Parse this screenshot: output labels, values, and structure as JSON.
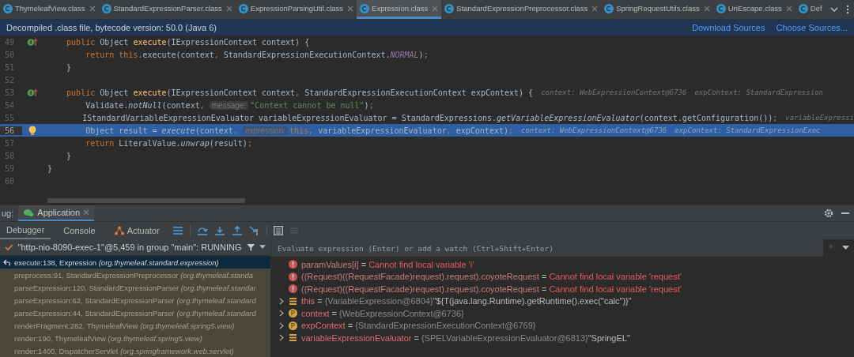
{
  "tabs": [
    {
      "label": "ThymeleafView.class",
      "selected": false,
      "closable": true
    },
    {
      "label": "StandardExpressionParser.class",
      "selected": false,
      "closable": true
    },
    {
      "label": "ExpressionParsingUtil.class",
      "selected": false,
      "closable": true
    },
    {
      "label": "Expression.class",
      "selected": true,
      "closable": true
    },
    {
      "label": "StandardExpressionPreprocessor.class",
      "selected": false,
      "closable": true
    },
    {
      "label": "SpringRequestUtils.class",
      "selected": false,
      "closable": true
    },
    {
      "label": "UriEscape.class",
      "selected": false,
      "closable": true
    },
    {
      "label": "Def",
      "selected": false,
      "closable": false
    }
  ],
  "banner": {
    "message": "Decompiled .class file, bytecode version: 50.0 (Java 6)",
    "links": [
      "Download Sources",
      "Choose Sources..."
    ]
  },
  "editor": {
    "lines": [
      {
        "number": "49",
        "kind": "override",
        "selected": false,
        "segments": [
          {
            "kind": "kw",
            "text": "    public "
          },
          {
            "kind": "plain",
            "text": "Object "
          },
          {
            "kind": "fn",
            "text": "execute"
          },
          {
            "kind": "plain",
            "text": "(IExpressionContext context) {"
          }
        ]
      },
      {
        "number": "50",
        "selected": false,
        "segments": [
          {
            "kind": "kw",
            "text": "        return this"
          },
          {
            "kind": "plain",
            "text": ".execute(context"
          },
          {
            "kind": "kw",
            "text": ", "
          },
          {
            "kind": "plain",
            "text": "StandardExpressionExecutionContext."
          },
          {
            "kind": "field",
            "text": "NORMAL"
          },
          {
            "kind": "plain",
            "text": ")"
          },
          {
            "kind": "kw",
            "text": ";"
          }
        ]
      },
      {
        "number": "51",
        "selected": false,
        "segments": [
          {
            "kind": "plain",
            "text": "    }"
          }
        ]
      },
      {
        "number": "52",
        "selected": false
      },
      {
        "number": "53",
        "kind": "override",
        "selected": false,
        "segments": [
          {
            "kind": "kw",
            "text": "    public "
          },
          {
            "kind": "plain",
            "text": "Object "
          },
          {
            "kind": "fn",
            "text": "execute"
          },
          {
            "kind": "plain",
            "text": "(IExpressionContext context"
          },
          {
            "kind": "kw",
            "text": ", "
          },
          {
            "kind": "plain",
            "text": "StandardExpressionExecutionContext expContext) {"
          },
          {
            "kind": "value",
            "text": "context: WebExpressionContext@6736"
          },
          {
            "kind": "value",
            "text": "expContext: StandardExpression"
          }
        ]
      },
      {
        "number": "54",
        "selected": false,
        "segments": [
          {
            "kind": "plain",
            "text": "        Validate."
          },
          {
            "kind": "static",
            "text": "notNull"
          },
          {
            "kind": "plain",
            "text": "(context"
          },
          {
            "kind": "kw",
            "text": ", "
          },
          {
            "kind": "hint",
            "text": "message:"
          },
          {
            "kind": "str",
            "text": "\"Context cannot be null\""
          },
          {
            "kind": "plain",
            "text": ")"
          },
          {
            "kind": "kw",
            "text": ";"
          }
        ]
      },
      {
        "number": "55",
        "selected": false,
        "segments": [
          {
            "kind": "plain",
            "text": "        IStandardVariableExpressionEvaluator variableExpressionEvaluator = StandardExpressions."
          },
          {
            "kind": "static",
            "text": "getVariableExpressionEvaluator"
          },
          {
            "kind": "plain",
            "text": "(context.getConfiguration())"
          },
          {
            "kind": "kw",
            "text": ";"
          },
          {
            "kind": "value",
            "text": "variableExpressi"
          }
        ]
      },
      {
        "number": "56",
        "kind": "bulb",
        "selected": true,
        "segments": [
          {
            "kind": "plain",
            "text": "        Object result = "
          },
          {
            "kind": "static",
            "text": "execute"
          },
          {
            "kind": "plain",
            "text": "(context"
          },
          {
            "kind": "kw",
            "text": ", "
          },
          {
            "kind": "hint",
            "text": "expression:"
          },
          {
            "kind": "kw",
            "text": "this, "
          },
          {
            "kind": "plain",
            "text": "variableExpressionEvaluator"
          },
          {
            "kind": "kw",
            "text": ", "
          },
          {
            "kind": "plain",
            "text": "expContext)"
          },
          {
            "kind": "kw",
            "text": ";"
          },
          {
            "kind": "value",
            "text": "context: WebExpressionContext@6736"
          },
          {
            "kind": "value",
            "text": "expContext: StandardExpressionExec"
          }
        ]
      },
      {
        "number": "57",
        "selected": false,
        "segments": [
          {
            "kind": "kw",
            "text": "        return "
          },
          {
            "kind": "plain",
            "text": "LiteralValue."
          },
          {
            "kind": "static",
            "text": "unwrap"
          },
          {
            "kind": "plain",
            "text": "(result)"
          },
          {
            "kind": "kw",
            "text": ";"
          }
        ]
      },
      {
        "number": "58",
        "selected": false,
        "segments": [
          {
            "kind": "plain",
            "text": "    }"
          }
        ]
      },
      {
        "number": "59",
        "selected": false,
        "segments": [
          {
            "kind": "plain",
            "text": "}"
          }
        ]
      },
      {
        "number": "60",
        "selected": false
      }
    ]
  },
  "debug": {
    "prefix": "ug:",
    "session": {
      "label": "Application",
      "selected": true
    },
    "tabs": [
      {
        "label": "Debugger",
        "selected": true,
        "kind": "text"
      },
      {
        "label": "Console",
        "selected": false,
        "kind": "text"
      },
      {
        "label": "Actuator",
        "selected": false,
        "kind": "actuator"
      }
    ],
    "thread": "\"http-nio-8090-exec-1\"@5,459 in group \"main\": RUNNING",
    "frames": [
      {
        "location": "execute:138, Expression",
        "package": "(org.thymeleaf.standard.expression)",
        "selected": true
      },
      {
        "location": "preprocess:91, StandardExpressionPreprocessor",
        "package": "(org.thymeleaf.standa",
        "selected": false
      },
      {
        "location": "parseExpression:120, StandardExpressionParser",
        "package": "(org.thymeleaf.standar",
        "selected": false
      },
      {
        "location": "parseExpression:62, StandardExpressionParser",
        "package": "(org.thymeleaf.standard",
        "selected": false
      },
      {
        "location": "parseExpression:44, StandardExpressionParser",
        "package": "(org.thymeleaf.standard",
        "selected": false
      },
      {
        "location": "renderFragment:282, ThymeleafView",
        "package": "(org.thymeleaf.spring5.view)",
        "selected": false
      },
      {
        "location": "render:190, ThymeleafView",
        "package": "(org.thymeleaf.spring5.view)",
        "selected": false
      },
      {
        "location": "render:1400, DispatcherServlet",
        "package": "(org.springframework.web.servlet)",
        "selected": false
      }
    ],
    "evaluate": {
      "placeholder": "Evaluate expression (Enter) or add a watch (Ctrl+Shift+Enter)"
    },
    "variables": [
      {
        "kind": "error",
        "name": "paramValues[i]",
        "operator": "=",
        "value": "Cannot find local variable 'i'"
      },
      {
        "kind": "error",
        "name": "((Request)((RequestFacade)request).request).coyoteRequest",
        "operator": "=",
        "value": "Cannot find local variable 'request'"
      },
      {
        "kind": "error",
        "name": "((Request)((RequestFacade)request).request).coyoteRequest",
        "operator": "=",
        "value": "Cannot find local variable 'request'"
      },
      {
        "kind": "field",
        "name": "this",
        "operator": "=",
        "value": "{VariableExpression@6804}",
        "extra": "\"${T(java.lang.Runtime).getRuntime().exec(\"calc\")}\""
      },
      {
        "kind": "param",
        "name": "context",
        "operator": "=",
        "value": "{WebExpressionContext@6736}"
      },
      {
        "kind": "param",
        "name": "expContext",
        "operator": "=",
        "value": "{StandardExpressionExecutionContext@6769}"
      },
      {
        "kind": "field",
        "name": "variableExpressionEvaluator",
        "operator": "=",
        "value": "{SPELVariableExpressionEvaluator@6813}",
        "extra": "\"SpringEL\""
      }
    ]
  }
}
